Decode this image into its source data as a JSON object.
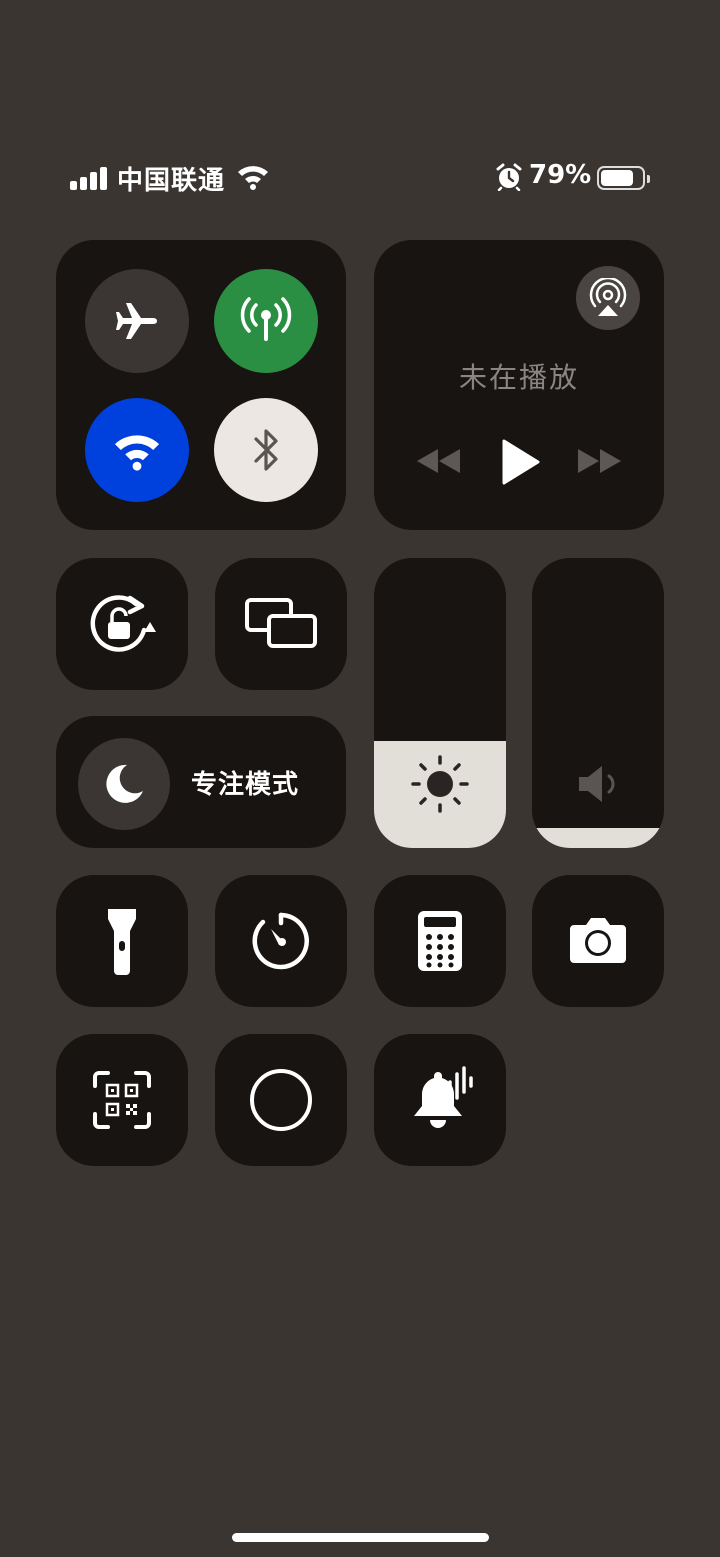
{
  "status_bar": {
    "carrier": "中国联通",
    "battery_percent": "79%",
    "battery_level": 0.79,
    "signal_bars": 4,
    "icons": [
      "signal-icon",
      "wifi-icon",
      "alarm-icon",
      "battery-icon"
    ]
  },
  "connectivity": {
    "airplane_mode": {
      "icon": "airplane-icon",
      "on": false
    },
    "cellular_data": {
      "icon": "antenna-icon",
      "on": true,
      "color": "#2a8f43"
    },
    "wifi": {
      "icon": "wifi-icon",
      "on": true,
      "color": "#0040dd"
    },
    "bluetooth": {
      "icon": "bluetooth-icon",
      "on": false
    }
  },
  "now_playing": {
    "label": "未在播放",
    "icons": [
      "airplay-icon",
      "rewind-icon",
      "play-icon",
      "fast-forward-icon"
    ]
  },
  "focus": {
    "label": "专注模式",
    "icon": "moon-icon"
  },
  "sliders": {
    "brightness": {
      "icon": "sun-icon",
      "level": 0.37
    },
    "volume": {
      "icon": "speaker-icon",
      "level": 0.07
    }
  },
  "controls": [
    "orientation-lock-icon",
    "screen-mirroring-icon",
    "flashlight-icon",
    "timer-icon",
    "calculator-icon",
    "camera-icon",
    "qr-code-scanner-icon",
    "screen-recording-icon",
    "sound-recognition-icon"
  ],
  "colors": {
    "background": "#3a3531",
    "tile": "#171411",
    "accent_green": "#2a8f43",
    "accent_blue": "#0040dd",
    "slider_fill": "#e2ded8"
  }
}
